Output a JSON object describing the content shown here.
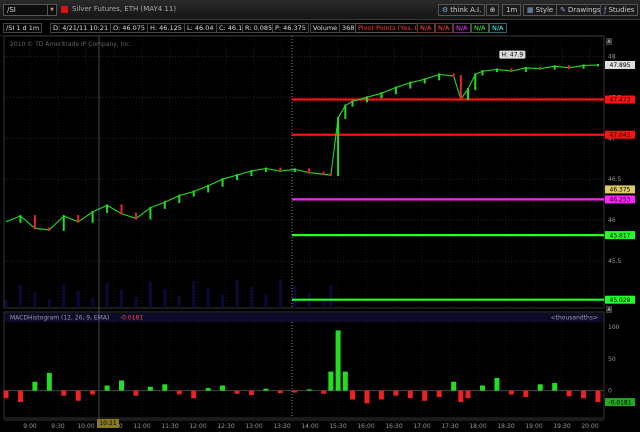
{
  "toolbar": {
    "symbol": "/SI",
    "description": "Silver Futures, ETH (MAY4 11)",
    "think_ai": "think A.I.",
    "interval": "1m",
    "style": "Style",
    "drawings": "Drawings",
    "studies": "Studies"
  },
  "info": {
    "symbol_tf": "/SI 1 d 1m",
    "date": "D: 4/21/11 10:21 AM",
    "open": "O: 46.075",
    "high": "H: 46.125",
    "low": "L: 46.04",
    "close": "C: 46.1",
    "range": "R: 0.085",
    "last": "P: 46.375",
    "volume_label": "Volume",
    "volume": "368",
    "pivot": "Pivot Points (Yes, DAY)",
    "na": "N/A"
  },
  "chart": {
    "copyright": "2010 © TD Ameritrade IP Company, Inc.",
    "high_label": "H: 47.9",
    "macd_label": "MACDHistogram (12, 26, 9, EMA)",
    "macd_value": "-0.0181",
    "macd_units": "<thousandths>"
  },
  "chart_data": {
    "type": "line",
    "symbol": "/SI",
    "price_axis": {
      "ticks": [
        {
          "label": "48",
          "value": 48
        },
        {
          "label": "47.5",
          "value": 47.5
        },
        {
          "label": "47",
          "value": 47
        },
        {
          "label": "46.5",
          "value": 46.5
        },
        {
          "label": "46",
          "value": 46
        },
        {
          "label": "45.5",
          "value": 45.5
        }
      ],
      "ylim": [
        45.0,
        48.2
      ]
    },
    "time_axis": {
      "ticks": [
        "9:00",
        "9:30",
        "10:00",
        "10:30",
        "11:00",
        "11:30",
        "12:00",
        "12:30",
        "13:00",
        "13:30",
        "14:00",
        "15:30",
        "16:00",
        "16:30",
        "17:00",
        "17:30",
        "18:00",
        "18:30",
        "19:00",
        "19:30",
        "20:00"
      ],
      "cursor_label": "10:21"
    },
    "last_price": {
      "label": "47.895",
      "value": 47.895,
      "color": "#dddddd"
    },
    "current_price": {
      "label": "46.375",
      "value": 46.375,
      "color": "#ddcc66"
    },
    "levels": [
      {
        "label": "47.473",
        "value": 47.473,
        "color": "#ff1111"
      },
      {
        "label": "47.043",
        "value": 47.043,
        "color": "#ff1111"
      },
      {
        "label": "46.253",
        "value": 46.253,
        "color": "#ff22ff"
      },
      {
        "label": "45.817",
        "value": 45.817,
        "color": "#22ff22"
      },
      {
        "label": "45.028",
        "value": 45.028,
        "color": "#22ff22"
      }
    ],
    "price_series": [
      [
        0,
        45.98
      ],
      [
        2,
        46.05
      ],
      [
        4,
        45.9
      ],
      [
        6,
        45.88
      ],
      [
        8,
        46.05
      ],
      [
        10,
        45.98
      ],
      [
        12,
        46.1
      ],
      [
        14,
        46.18
      ],
      [
        16,
        46.08
      ],
      [
        18,
        46.02
      ],
      [
        20,
        46.15
      ],
      [
        22,
        46.22
      ],
      [
        24,
        46.3
      ],
      [
        26,
        46.35
      ],
      [
        28,
        46.42
      ],
      [
        30,
        46.5
      ],
      [
        32,
        46.55
      ],
      [
        34,
        46.6
      ],
      [
        36,
        46.63
      ],
      [
        38,
        46.6
      ],
      [
        40,
        46.62
      ],
      [
        42,
        46.58
      ],
      [
        44,
        46.56
      ],
      [
        45,
        46.55
      ],
      [
        46,
        47.25
      ],
      [
        47,
        47.4
      ],
      [
        48,
        47.45
      ],
      [
        50,
        47.5
      ],
      [
        52,
        47.55
      ],
      [
        54,
        47.62
      ],
      [
        56,
        47.68
      ],
      [
        58,
        47.72
      ],
      [
        60,
        47.78
      ],
      [
        62,
        47.76
      ],
      [
        63,
        47.48
      ],
      [
        64,
        47.6
      ],
      [
        65,
        47.78
      ],
      [
        66,
        47.82
      ],
      [
        68,
        47.84
      ],
      [
        70,
        47.82
      ],
      [
        72,
        47.86
      ],
      [
        74,
        47.85
      ],
      [
        76,
        47.88
      ],
      [
        78,
        47.86
      ],
      [
        80,
        47.89
      ],
      [
        82,
        47.895
      ]
    ],
    "macd_axis": {
      "ticks": [
        {
          "label": "100",
          "value": 100
        },
        {
          "label": "50",
          "value": 50
        },
        {
          "label": "0",
          "value": 0
        }
      ],
      "ylim": [
        -40,
        105
      ]
    },
    "macd_last": {
      "label": "-0.0181",
      "value": -18.1
    },
    "macd_series": [
      [
        0,
        -12
      ],
      [
        2,
        -18
      ],
      [
        4,
        14
      ],
      [
        6,
        28
      ],
      [
        8,
        -8
      ],
      [
        10,
        -16
      ],
      [
        12,
        -6
      ],
      [
        14,
        8
      ],
      [
        16,
        16
      ],
      [
        18,
        -8
      ],
      [
        20,
        6
      ],
      [
        22,
        10
      ],
      [
        24,
        -6
      ],
      [
        26,
        -12
      ],
      [
        28,
        4
      ],
      [
        30,
        8
      ],
      [
        32,
        -5
      ],
      [
        34,
        -7
      ],
      [
        36,
        3
      ],
      [
        38,
        -4
      ],
      [
        40,
        -3
      ],
      [
        42,
        2
      ],
      [
        44,
        -5
      ],
      [
        45,
        30
      ],
      [
        46,
        95
      ],
      [
        47,
        30
      ],
      [
        48,
        -14
      ],
      [
        50,
        -20
      ],
      [
        52,
        -14
      ],
      [
        54,
        -8
      ],
      [
        56,
        -12
      ],
      [
        58,
        -16
      ],
      [
        60,
        -10
      ],
      [
        62,
        14
      ],
      [
        63,
        -18
      ],
      [
        64,
        -12
      ],
      [
        66,
        8
      ],
      [
        68,
        20
      ],
      [
        70,
        -6
      ],
      [
        72,
        -10
      ],
      [
        74,
        10
      ],
      [
        76,
        12
      ],
      [
        78,
        -9
      ],
      [
        80,
        -12
      ],
      [
        82,
        -18
      ]
    ],
    "colors": {
      "up": "#22dd22",
      "down": "#ee2222",
      "grid": "#2a2a2a"
    }
  }
}
